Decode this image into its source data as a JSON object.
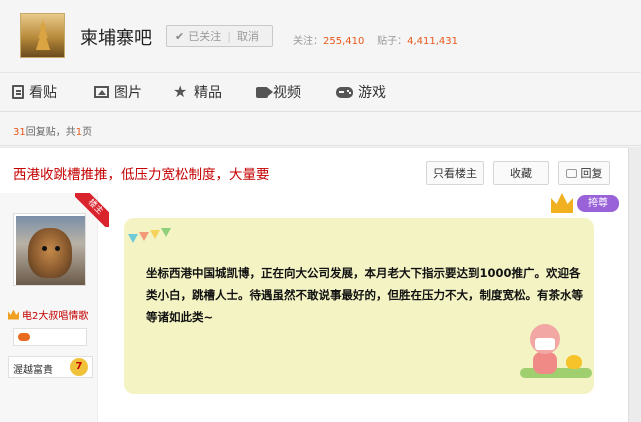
{
  "header": {
    "forum_name": "柬埔寨吧",
    "follow_label": "已关注",
    "cancel_label": "取消",
    "followers_label": "关注：",
    "followers_count": "255,410",
    "posts_label": "贴子：",
    "posts_count": "4,411,431"
  },
  "nav": {
    "items": [
      {
        "label": "看贴",
        "icon": "document-icon"
      },
      {
        "label": "图片",
        "icon": "picture-icon"
      },
      {
        "label": "精品",
        "icon": "star-icon"
      },
      {
        "label": "视频",
        "icon": "video-icon"
      },
      {
        "label": "游戏",
        "icon": "gamepad-icon"
      }
    ]
  },
  "reply_bar": {
    "count": "31",
    "suffix": "回复贴，共",
    "pages": "1",
    "pages_suffix": "页"
  },
  "thread": {
    "title": "西港收跳槽推推，低压力宽松制度，大量要",
    "buttons": {
      "only_op": "只看楼主",
      "favorite": "收藏",
      "reply": "回复"
    }
  },
  "user": {
    "op_badge": "楼主",
    "title_line": "电2大叔唱情歌",
    "level_text": "渥越富貴",
    "level": "7"
  },
  "post": {
    "vip_label": "挎尊",
    "content": "坐标西港中国城凯博，正在向大公司发展，本月老大下指示要达到1000推广。欢迎各类小白，跳槽人士。待遇虽然不敢说事最好的，但胜在压力不大，制度宽松。有茶水等等诸如此类~"
  },
  "colors": {
    "accent_red": "#c40000",
    "count_orange": "#e8571a",
    "post_background": "#f4f3c4",
    "vip_purple": "#9a62d8"
  }
}
